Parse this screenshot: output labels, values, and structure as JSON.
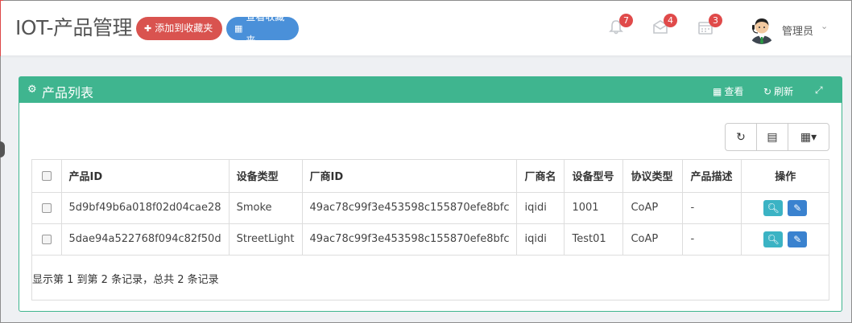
{
  "header": {
    "title": "IOT-产品管理",
    "fav_add_label": "添加到收藏夹",
    "fav_view_label": "查看收藏夹",
    "notifications": [
      {
        "icon": "bell-icon",
        "count": "7"
      },
      {
        "icon": "envelope-icon",
        "count": "4"
      },
      {
        "icon": "calendar-icon",
        "count": "3"
      }
    ],
    "user_name": "管理员"
  },
  "panel": {
    "title": "产品列表",
    "view_label": "查看",
    "refresh_label": "刷新"
  },
  "table": {
    "columns": [
      "产品ID",
      "设备类型",
      "厂商ID",
      "厂商名",
      "设备型号",
      "协议类型",
      "产品描述",
      "操作"
    ],
    "rows": [
      [
        "5d9bf49b6a018f02d04cae28",
        "Smoke",
        "49ac78c99f3e453598c155870efe8bfc",
        "iqidi",
        "1001",
        "CoAP",
        "-"
      ],
      [
        "5dae94a522768f094c82f50d",
        "StreetLight",
        "49ac78c99f3e453598c155870efe8bfc",
        "iqidi",
        "Test01",
        "CoAP",
        "-"
      ]
    ]
  },
  "pager": {
    "text": "显示第 1 到第 2 条记录，总共 2 条记录"
  },
  "colors": {
    "panel": "#3fb58f",
    "badge": "#e04a4a",
    "fav_add": "#d9534f",
    "fav_view": "#4a90d9",
    "op_search": "#3bb3c4",
    "op_edit": "#3a82cf"
  }
}
